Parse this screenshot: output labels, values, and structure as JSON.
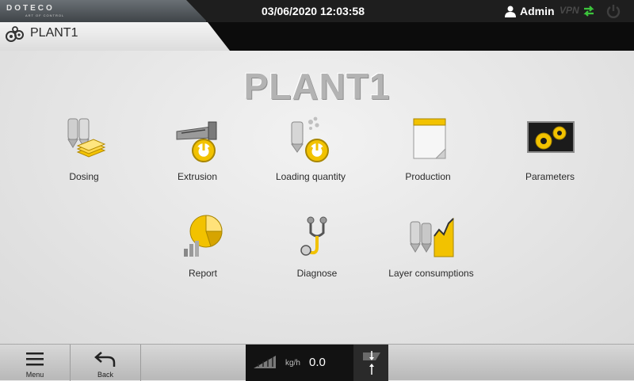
{
  "header": {
    "logo": "DOTECO",
    "logo_tagline": "ART OF CONTROL",
    "datetime": "03/06/2020 12:03:58",
    "user": "Admin",
    "vpn": "VPN",
    "colors": {
      "accent": "#f2c200",
      "sync": "#3cc53c"
    }
  },
  "subheader": {
    "plant": "PLANT1"
  },
  "main": {
    "title": "PLANT1",
    "tiles": [
      {
        "label": "Dosing",
        "icon": "dosing-icon"
      },
      {
        "label": "Extrusion",
        "icon": "extrusion-icon"
      },
      {
        "label": "Loading quantity",
        "icon": "loading-quantity-icon"
      },
      {
        "label": "Production",
        "icon": "production-icon"
      },
      {
        "label": "Parameters",
        "icon": "parameters-icon"
      },
      {
        "label": "Report",
        "icon": "report-icon"
      },
      {
        "label": "Diagnose",
        "icon": "diagnose-icon"
      },
      {
        "label": "Layer consumptions",
        "icon": "layer-consumptions-icon"
      }
    ]
  },
  "footer": {
    "menu_label": "Menu",
    "back_label": "Back",
    "flow_unit": "kg/h",
    "flow_value": "0.0"
  }
}
